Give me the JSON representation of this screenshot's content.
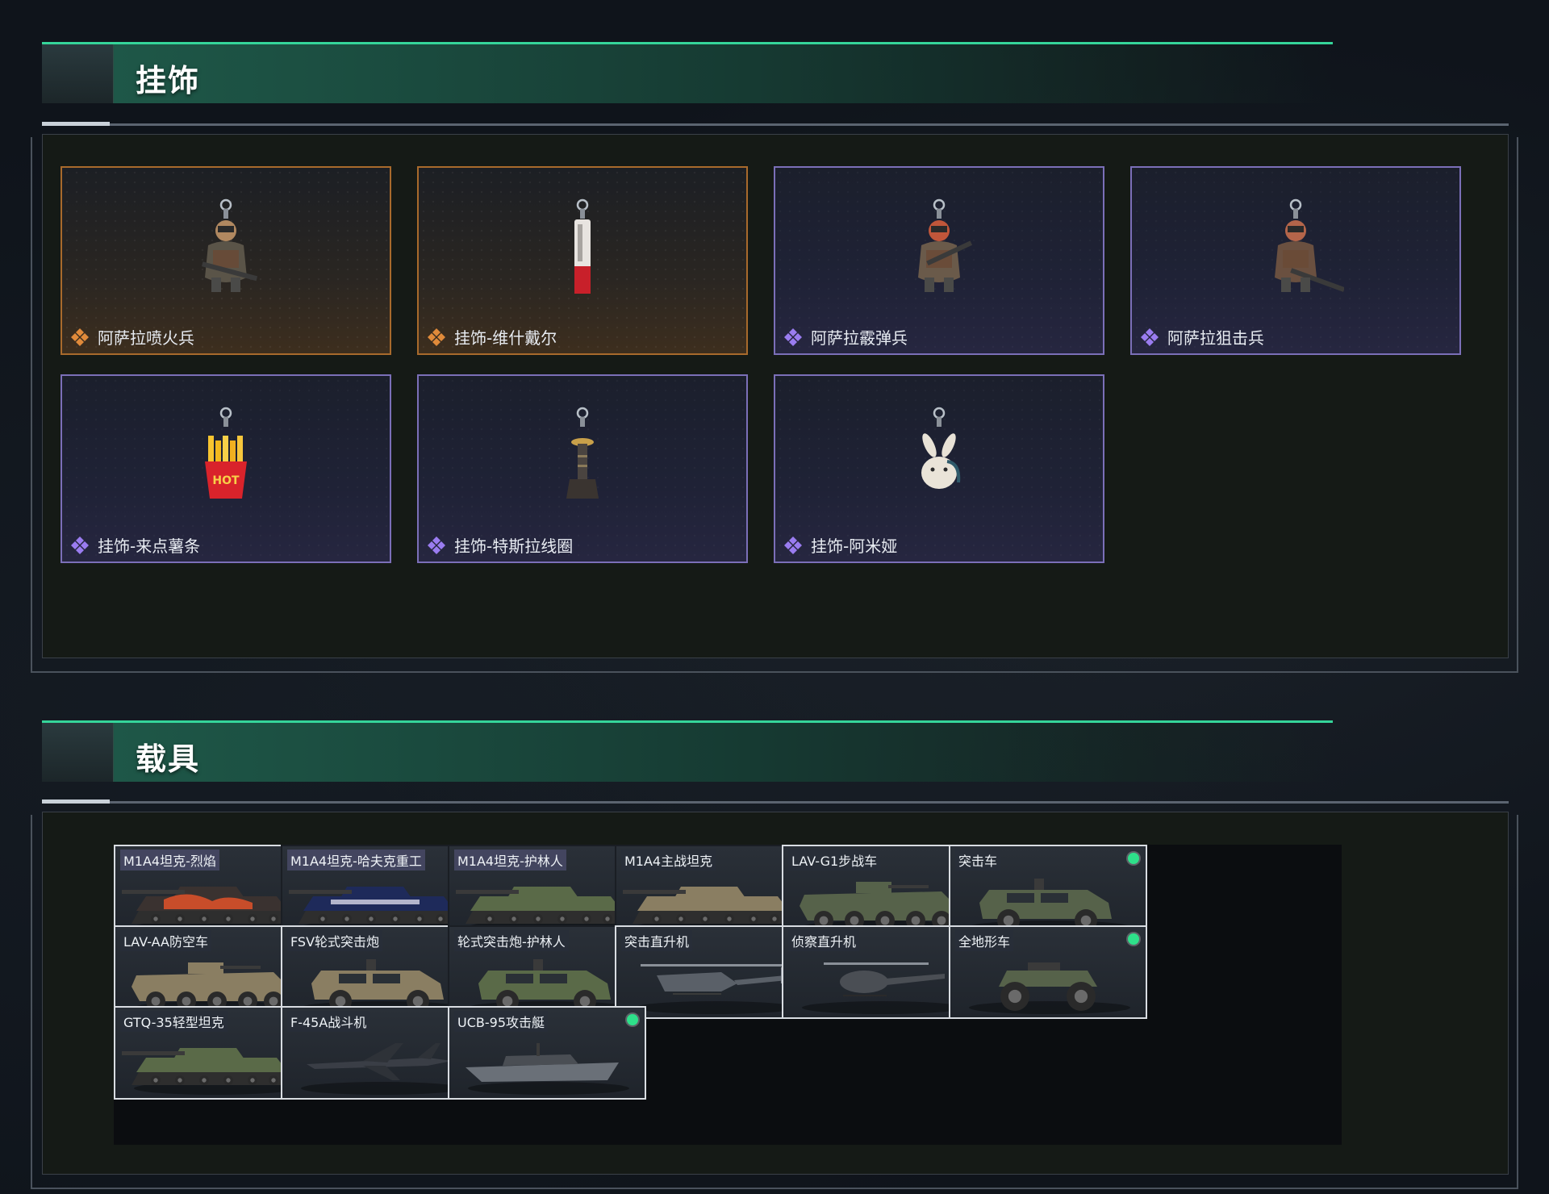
{
  "sections": {
    "charms": {
      "title": "挂饰"
    },
    "vehicles": {
      "title": "载具"
    }
  },
  "charms": [
    {
      "label": "阿萨拉喷火兵",
      "rarity": "gold",
      "icon": "flamethrower-soldier-charm-icon"
    },
    {
      "label": "挂饰-维什戴尔",
      "rarity": "gold",
      "icon": "red-tube-charm-icon"
    },
    {
      "label": "阿萨拉霰弹兵",
      "rarity": "purple",
      "icon": "shotgunner-charm-icon"
    },
    {
      "label": "阿萨拉狙击兵",
      "rarity": "purple",
      "icon": "sniper-charm-icon"
    },
    {
      "label": "挂饰-来点薯条",
      "rarity": "purple",
      "icon": "fries-charm-icon"
    },
    {
      "label": "挂饰-特斯拉线圈",
      "rarity": "purple",
      "icon": "tesla-coil-charm-icon"
    },
    {
      "label": "挂饰-阿米娅",
      "rarity": "purple",
      "icon": "bunny-charm-icon"
    }
  ],
  "vehicles": [
    {
      "label": "M1A4坦克-烈焰",
      "owned": true,
      "framed": true,
      "kind": "tank",
      "skin": "flame"
    },
    {
      "label": "M1A4坦克-哈夫克重工",
      "owned": false,
      "framed": false,
      "kind": "tank",
      "skin": "blue"
    },
    {
      "label": "M1A4坦克-护林人",
      "owned": false,
      "framed": false,
      "kind": "tank",
      "skin": "camo"
    },
    {
      "label": "M1A4主战坦克",
      "owned": false,
      "framed": false,
      "kind": "tank",
      "skin": "sand"
    },
    {
      "label": "LAV-G1步战车",
      "owned": true,
      "framed": true,
      "kind": "apc",
      "skin": "green"
    },
    {
      "label": "突击车",
      "owned": true,
      "framed": true,
      "kind": "suv",
      "skin": "green"
    },
    {
      "label": "LAV-AA防空车",
      "owned": true,
      "framed": true,
      "kind": "apc",
      "skin": "sand"
    },
    {
      "label": "FSV轮式突击炮",
      "owned": true,
      "framed": true,
      "kind": "suv",
      "skin": "sand"
    },
    {
      "label": "轮式突击炮-护林人",
      "owned": false,
      "framed": false,
      "kind": "suv",
      "skin": "camo"
    },
    {
      "label": "突击直升机",
      "owned": true,
      "framed": true,
      "kind": "heli",
      "skin": "gray"
    },
    {
      "label": "侦察直升机",
      "owned": true,
      "framed": true,
      "kind": "heli-small",
      "skin": "gray"
    },
    {
      "label": "全地形车",
      "owned": true,
      "framed": true,
      "kind": "atv",
      "skin": "green"
    },
    {
      "label": "GTQ-35轻型坦克",
      "owned": true,
      "framed": true,
      "kind": "tank",
      "skin": "camo"
    },
    {
      "label": "F-45A战斗机",
      "owned": true,
      "framed": true,
      "kind": "jet",
      "skin": "gray"
    },
    {
      "label": "UCB-95攻击艇",
      "owned": true,
      "framed": true,
      "kind": "boat",
      "skin": "gray"
    }
  ],
  "colors": {
    "accent_green": "#35d59a",
    "gold_rarity": "#e08a3a",
    "purple_rarity": "#9a7cf0",
    "owned_dot": "#2ee08a"
  }
}
